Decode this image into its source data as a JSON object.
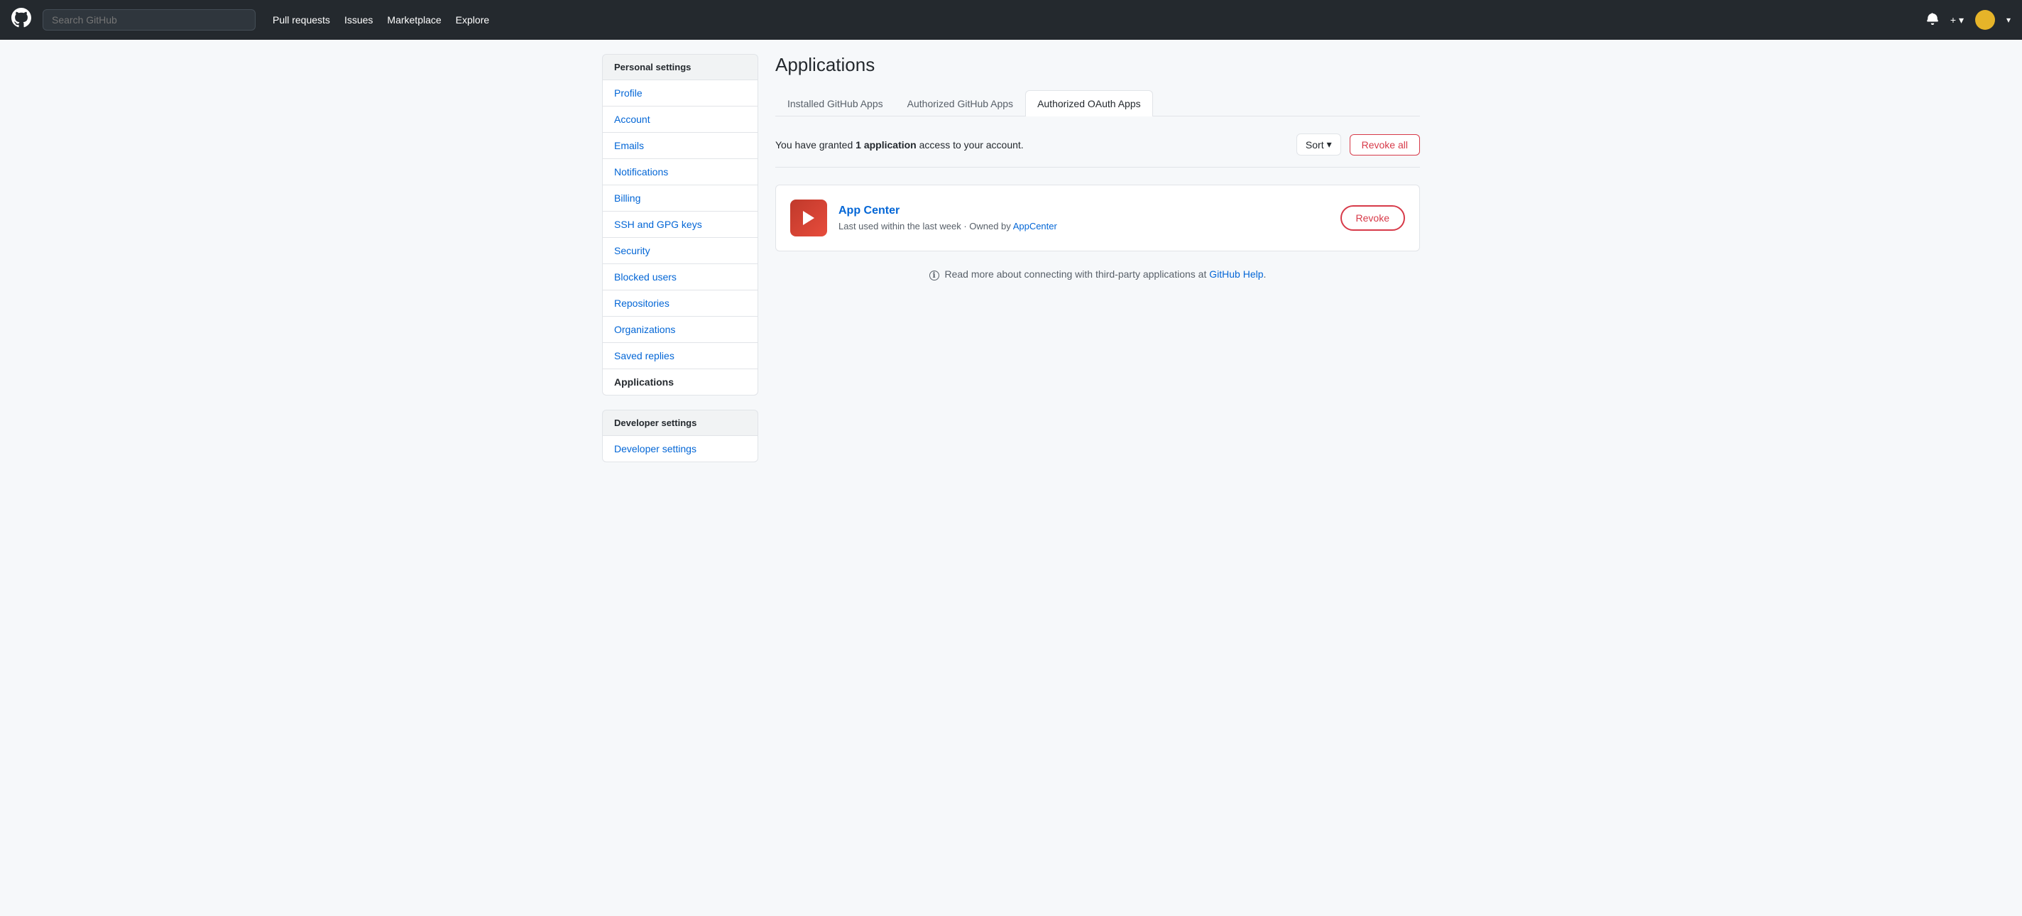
{
  "navbar": {
    "logo_symbol": "⬤",
    "search_placeholder": "Search GitHub",
    "links": [
      {
        "label": "Pull requests",
        "key": "pull-requests"
      },
      {
        "label": "Issues",
        "key": "issues"
      },
      {
        "label": "Marketplace",
        "key": "marketplace"
      },
      {
        "label": "Explore",
        "key": "explore"
      }
    ],
    "notification_icon": "🔔",
    "plus_label": "+ ▾",
    "avatar_label": "▾"
  },
  "sidebar": {
    "personal_settings_label": "Personal settings",
    "items": [
      {
        "label": "Profile",
        "key": "profile",
        "active": false
      },
      {
        "label": "Account",
        "key": "account",
        "active": false
      },
      {
        "label": "Emails",
        "key": "emails",
        "active": false
      },
      {
        "label": "Notifications",
        "key": "notifications",
        "active": false
      },
      {
        "label": "Billing",
        "key": "billing",
        "active": false
      },
      {
        "label": "SSH and GPG keys",
        "key": "ssh-gpg",
        "active": false
      },
      {
        "label": "Security",
        "key": "security",
        "active": false
      },
      {
        "label": "Blocked users",
        "key": "blocked-users",
        "active": false
      },
      {
        "label": "Repositories",
        "key": "repositories",
        "active": false
      },
      {
        "label": "Organizations",
        "key": "organizations",
        "active": false
      },
      {
        "label": "Saved replies",
        "key": "saved-replies",
        "active": false
      },
      {
        "label": "Applications",
        "key": "applications",
        "active": true
      }
    ],
    "developer_section_label": "Developer settings",
    "developer_items": [
      {
        "label": "Developer settings",
        "key": "developer-settings"
      }
    ]
  },
  "main": {
    "page_title": "Applications",
    "tabs": [
      {
        "label": "Installed GitHub Apps",
        "key": "installed",
        "active": false
      },
      {
        "label": "Authorized GitHub Apps",
        "key": "authorized",
        "active": false
      },
      {
        "label": "Authorized OAuth Apps",
        "key": "oauth",
        "active": true
      }
    ],
    "info_text_prefix": "You have granted ",
    "info_count": "1",
    "info_text_middle": " application",
    "info_text_suffix": " access to your account.",
    "sort_label": "Sort",
    "sort_caret": "▾",
    "revoke_all_label": "Revoke all",
    "app": {
      "icon_symbol": "▶",
      "name": "App Center",
      "meta_prefix": "Last used within the last week · Owned by ",
      "owner_link_text": "AppCenter",
      "revoke_label": "Revoke"
    },
    "info_note_prefix": "Read more about connecting with third-party applications at ",
    "info_note_link": "GitHub Help",
    "info_note_suffix": "."
  }
}
